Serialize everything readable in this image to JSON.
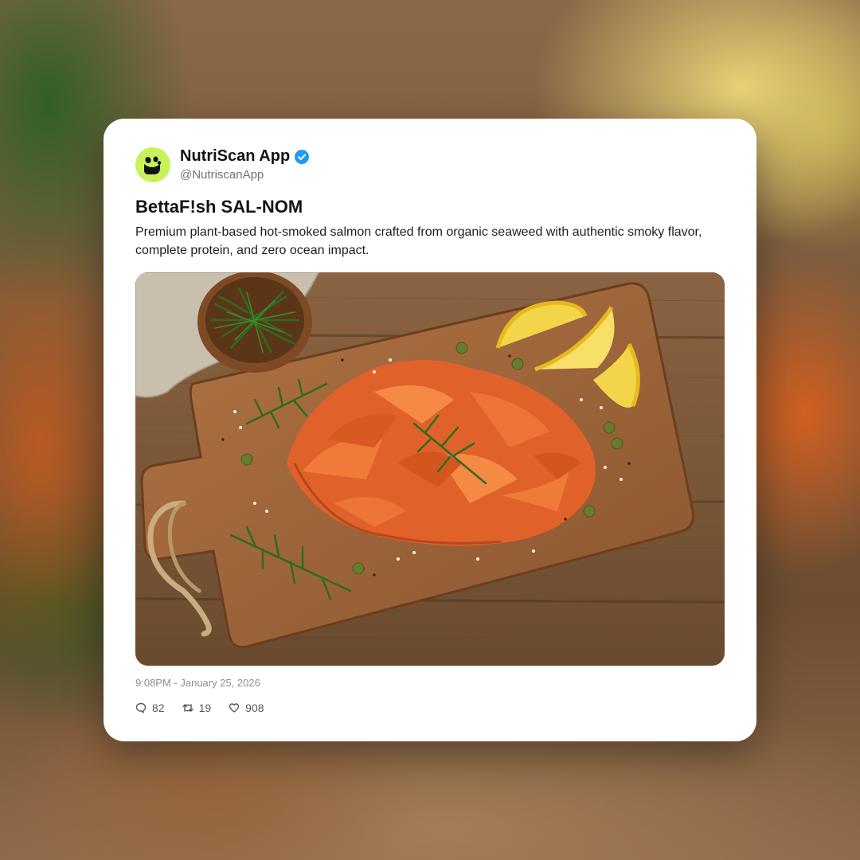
{
  "post": {
    "author_name": "NutriScan App",
    "author_handle": "@NutriscanApp",
    "verified": true,
    "title": "BettaF!sh SAL-NOM",
    "description": "Premium plant-based hot-smoked salmon crafted from organic seaweed with authentic smoky flavor, complete protein, and zero ocean impact.",
    "timestamp": "9:08PM - January 25, 2026",
    "image_icon": "smoked-salmon-board-photo"
  },
  "stats": {
    "replies": "82",
    "reposts": "19",
    "likes": "908"
  },
  "colors": {
    "avatar_bg": "#c8f25a",
    "verified_badge": "#1d9bf0",
    "card_bg": "#ffffff"
  }
}
